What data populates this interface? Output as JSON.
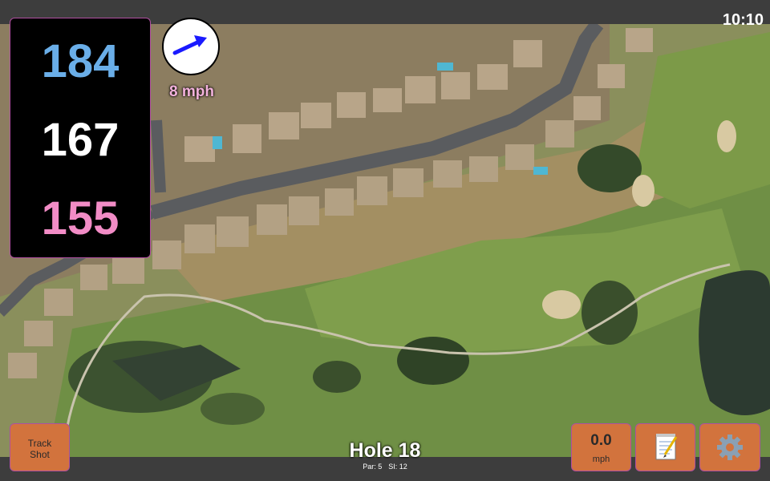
{
  "status": {
    "clock": "10:10"
  },
  "distances": {
    "back": "184",
    "middle": "167",
    "front": "155"
  },
  "wind": {
    "speed": "8 mph",
    "direction_icon": "wind-arrow-icon"
  },
  "hole": {
    "title": "Hole 18",
    "par": "Par: 5",
    "stroke_index": "SI: 12"
  },
  "buttons": {
    "track_shot": "Track\nShot",
    "speed_value": "0.0",
    "speed_unit": "mph",
    "notes_icon": "notepad-icon",
    "settings_icon": "gear-icon"
  },
  "colors": {
    "back_distance": "#6aaee8",
    "middle_distance": "#ffffff",
    "front_distance": "#f28cc6",
    "button": "#d2733d",
    "wind_arrow": "#1a1aff"
  }
}
